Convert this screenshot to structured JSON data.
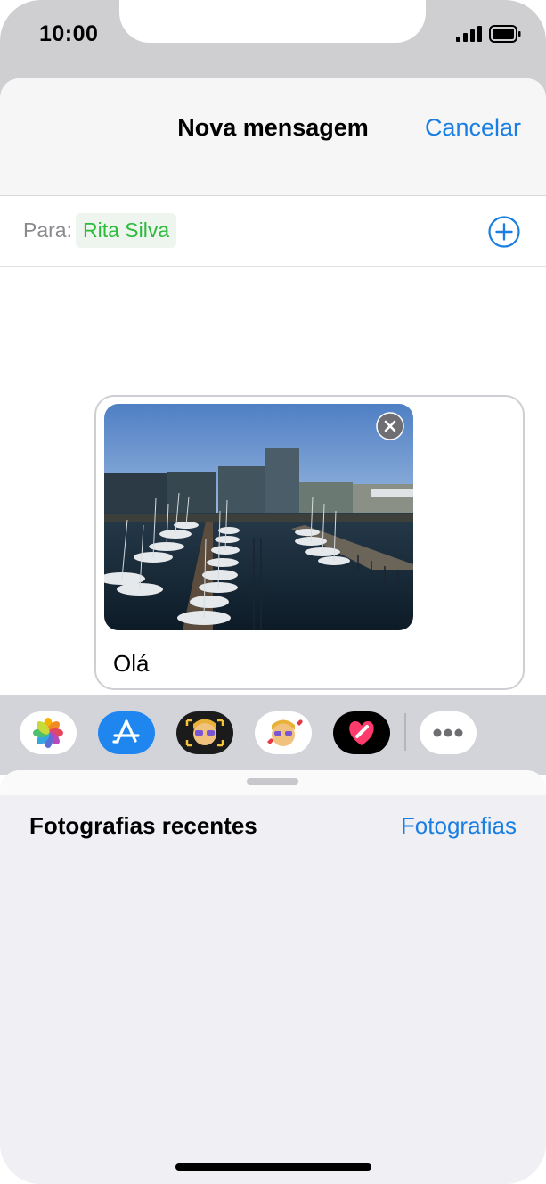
{
  "status_bar": {
    "time": "10:00"
  },
  "nav": {
    "title": "Nova mensagem",
    "cancel_label": "Cancelar"
  },
  "recipient": {
    "label": "Para:",
    "name": "Rita Silva"
  },
  "compose": {
    "message_text": "Olá"
  },
  "app_tray": {
    "apps": [
      "photos-icon",
      "app-store-icon",
      "memoji-camera-icon",
      "memoji-stickers-icon",
      "digital-touch-icon",
      "more-apps-icon"
    ]
  },
  "photo_panel": {
    "title": "Fotografias recentes",
    "link_label": "Fotografias"
  },
  "colors": {
    "accent_blue": "#1a7fe0",
    "recipient_green": "#2dbb3b",
    "send_green": "#34c759"
  }
}
